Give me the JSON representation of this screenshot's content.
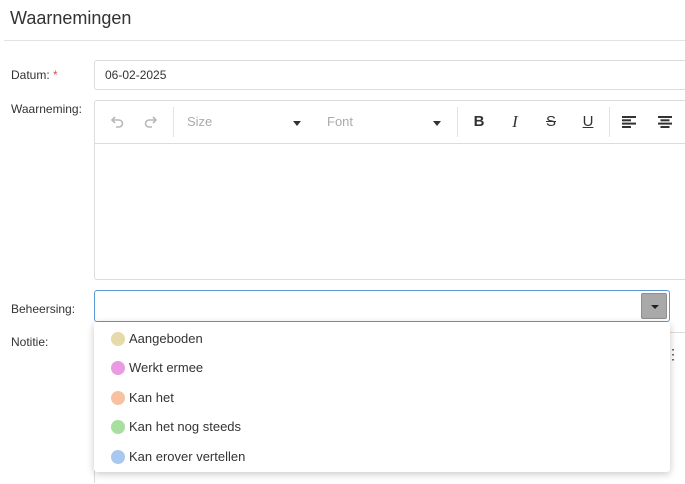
{
  "title": "Waarnemingen",
  "form": {
    "datum_label": "Datum:",
    "datum_required": "*",
    "datum_value": "06-02-2025",
    "waarneming_label": "Waarneming:",
    "beheersing_label": "Beheersing:",
    "beheersing_value": "",
    "notitie_label": "Notitie:"
  },
  "toolbar": {
    "size_label": "Size",
    "font_label": "Font",
    "bold": "B",
    "italic": "I",
    "strike": "S",
    "underline": "U",
    "undo_icon": "undo-icon",
    "redo_icon": "redo-icon"
  },
  "dropdown": {
    "options": [
      {
        "label": "Aangeboden",
        "color": "#e6d9aa"
      },
      {
        "label": "Werkt ermee",
        "color": "#e89ae2"
      },
      {
        "label": "Kan het",
        "color": "#f8c2a2"
      },
      {
        "label": "Kan het nog steeds",
        "color": "#a8dfa0"
      },
      {
        "label": "Kan erover vertellen",
        "color": "#a8c8ef"
      }
    ]
  }
}
